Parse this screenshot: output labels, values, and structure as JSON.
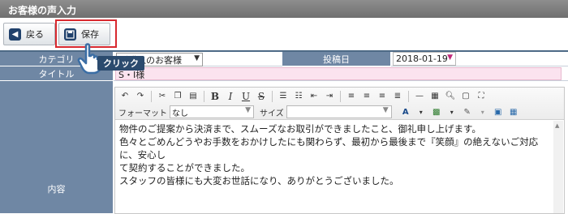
{
  "window": {
    "title": "お客様の声入力"
  },
  "toolbar": {
    "back_label": "戻る",
    "save_label": "保存"
  },
  "annotation": {
    "click_label": "クリック"
  },
  "form": {
    "category": {
      "label": "カテゴリ",
      "value": "ご購入のお客様"
    },
    "post_date": {
      "label": "投稿日",
      "value": "2018-01-19"
    },
    "title": {
      "label": "タイトル",
      "value": "S・I様"
    },
    "content": {
      "label": "内容",
      "lines": [
        "物件のご提案から決済まで、スムーズなお取引ができましたこと、御礼申し上げます。",
        "色々とごめんどうやお手数をおかけしたにも関わらず、最初から最後まで『笑顔』の絶えないご対応に、安心し",
        "て契約することができました。",
        "スタッフの皆様にも大変お世話になり、ありがとうございました。"
      ]
    }
  },
  "editor": {
    "format_label": "フォーマット",
    "format_value": "なし",
    "size_label": "サイズ",
    "size_value": ""
  },
  "colors": {
    "label_bg": "#6f87a4",
    "title_bg": "#fbe3ef",
    "highlight": "#d8292f",
    "titlebar": "#7d7d7d"
  }
}
